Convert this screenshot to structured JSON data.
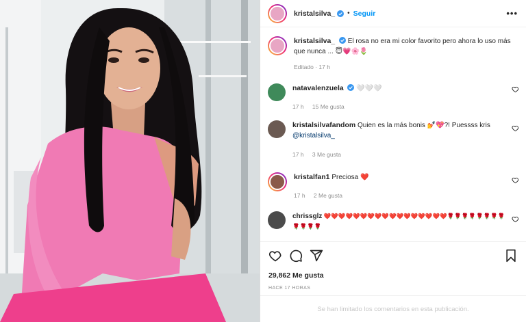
{
  "post": {
    "username": "kristalsilva_",
    "follow_label": "Seguir",
    "more_label": "•••",
    "caption_user": "kristalsilva_",
    "caption_text": "El rosa no era mi color favorito pero ahora lo uso más que nunca ... 😇💗🌸🌷",
    "caption_meta": "Editado · 17 h"
  },
  "comments": [
    {
      "user": "natavalenzuela",
      "verified": true,
      "text": "🤍🤍🤍",
      "mention": "",
      "time": "17 h",
      "likes": "15 Me gusta"
    },
    {
      "user": "kristalsilvafandom",
      "verified": false,
      "text": "Quien es la más bonis 💅💖?! Puessss kris",
      "mention": "@kristalsilva_",
      "time": "17 h",
      "likes": "3 Me gusta"
    },
    {
      "user": "kristalfan1",
      "verified": false,
      "text": "Preciosa ❤️",
      "mention": "",
      "time": "17 h",
      "likes": "2 Me gusta"
    },
    {
      "user": "chrissglz",
      "verified": false,
      "text": "❤️❤️❤️❤️❤️❤️❤️❤️❤️❤️❤️❤️❤️❤️❤️❤️❤️🌹🌹🌹🌹🌹🌹🌹🌹🌹🌹🌹🌹",
      "mention": "",
      "time": "",
      "likes": ""
    }
  ],
  "footer": {
    "likes": "29,862 Me gusta",
    "ago": "HACE 17 HORAS",
    "limited": "Se han limitado los comentarios en esta publicación."
  },
  "icons": [
    "heart-icon",
    "comment-icon",
    "share-icon",
    "bookmark-icon",
    "verified-icon",
    "more-icon"
  ],
  "colors": {
    "accent": "#0095f6",
    "text": "#262626",
    "muted": "#8e8e8e",
    "verified": "#3897f0",
    "dress": "#f07ab4",
    "skirt": "#ee3f8c"
  }
}
